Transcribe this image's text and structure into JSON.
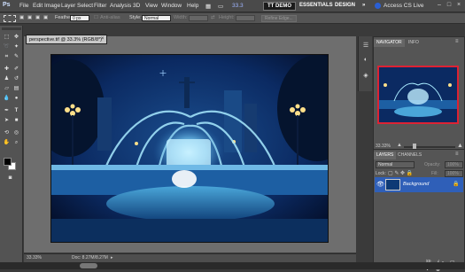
{
  "app": {
    "logo": "Ps",
    "menu": [
      "File",
      "Edit",
      "Image",
      "Layer",
      "Select",
      "Filter",
      "Analysis",
      "3D",
      "View",
      "Window",
      "Help"
    ],
    "zoom_value": "33.3",
    "workspace_active": "TT DEMO",
    "workspaces": [
      "ESSENTIALS",
      "DESIGN"
    ],
    "workspace_more": "»",
    "live_label": "Access CS Live"
  },
  "options": {
    "feather_label": "Feather:",
    "feather_value": "0 px",
    "antialias_label": "Anti-alias",
    "style_label": "Style:",
    "style_value": "Normal",
    "width_label": "Width:",
    "height_label": "Height:",
    "refine_label": "Refine Edge..."
  },
  "document": {
    "tab_title": "perspective.tif @ 33.3% (RGB/8*)",
    "close_glyph": "×",
    "zoom": "33.33%",
    "doc_info": "Doc: 8.27M/8.27M"
  },
  "navigator": {
    "tabs": [
      "NAVIGATOR",
      "INFO"
    ],
    "zoom": "33.33%"
  },
  "layers": {
    "tabs": [
      "LAYERS",
      "CHANNELS"
    ],
    "blend_mode": "Normal",
    "opacity_label": "Opacity:",
    "opacity_value": "100%",
    "lock_label": "Lock:",
    "fill_label": "Fill:",
    "fill_value": "100%",
    "layer_name": "Background"
  },
  "colors": {
    "accent_red": "#d22233",
    "layer_selected": "#2f5fb8"
  },
  "icons": {
    "tools": [
      "marquee-icon",
      "move-icon",
      "lasso-icon",
      "magic-wand-icon",
      "crop-icon",
      "eyedropper-icon",
      "healing-icon",
      "brush-icon",
      "clone-stamp-icon",
      "history-brush-icon",
      "eraser-icon",
      "gradient-icon",
      "blur-icon",
      "dodge-icon",
      "pen-icon",
      "type-icon",
      "path-select-icon",
      "shape-icon",
      "3d-rotate-icon",
      "3d-orbit-icon",
      "hand-icon",
      "zoom-icon"
    ]
  }
}
